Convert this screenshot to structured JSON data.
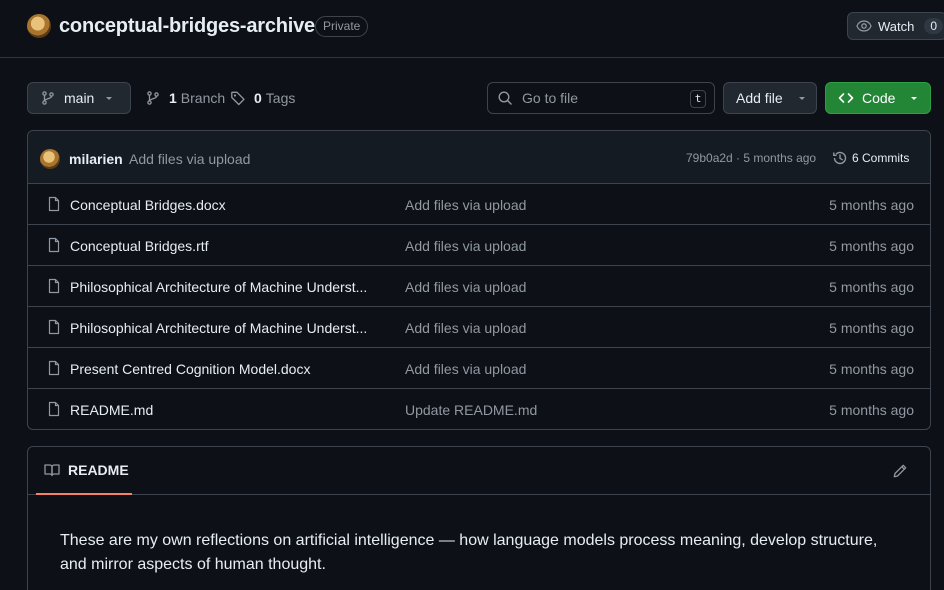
{
  "repo": {
    "name": "conceptual-bridges-archive",
    "visibility": "Private"
  },
  "watch": {
    "label": "Watch",
    "count": "0"
  },
  "toolbar": {
    "branch_label": "main",
    "branch_count": "1",
    "branch_word": "Branch",
    "tag_count": "0",
    "tag_word": "Tags",
    "search_placeholder": "Go to file",
    "search_shortcut": "t",
    "add_file_label": "Add file",
    "code_label": "Code"
  },
  "latest_commit": {
    "author": "milarien",
    "message": "Add files via upload",
    "hash_and_time": "79b0a2d · 5 months ago",
    "commits_label": "6 Commits"
  },
  "files": [
    {
      "name": "Conceptual Bridges.docx",
      "commit": "Add files via upload",
      "date": "5 months ago"
    },
    {
      "name": "Conceptual Bridges.rtf",
      "commit": "Add files via upload",
      "date": "5 months ago"
    },
    {
      "name": "Philosophical Architecture of Machine Underst...",
      "commit": "Add files via upload",
      "date": "5 months ago"
    },
    {
      "name": "Philosophical Architecture of Machine Underst...",
      "commit": "Add files via upload",
      "date": "5 months ago"
    },
    {
      "name": "Present Centred Cognition Model.docx",
      "commit": "Add files via upload",
      "date": "5 months ago"
    },
    {
      "name": "README.md",
      "commit": "Update README.md",
      "date": "5 months ago"
    }
  ],
  "readme": {
    "tab_label": "README",
    "text": "These are my own reflections on artificial intelligence — how language models process meaning, develop structure, and mirror aspects of human thought."
  },
  "colors": {
    "background": "#0d1117",
    "border": "#3d444d",
    "code_button": "#238636",
    "readme_tab_underline": "#f78166",
    "muted_text": "#9198a1"
  },
  "icons": {
    "watch": "eye-icon",
    "branch": "git-branch-icon",
    "tag": "tag-icon",
    "search": "search-icon",
    "code": "code-icon",
    "history": "history-icon",
    "file": "file-icon",
    "readme": "book-icon",
    "edit": "pencil-icon"
  }
}
